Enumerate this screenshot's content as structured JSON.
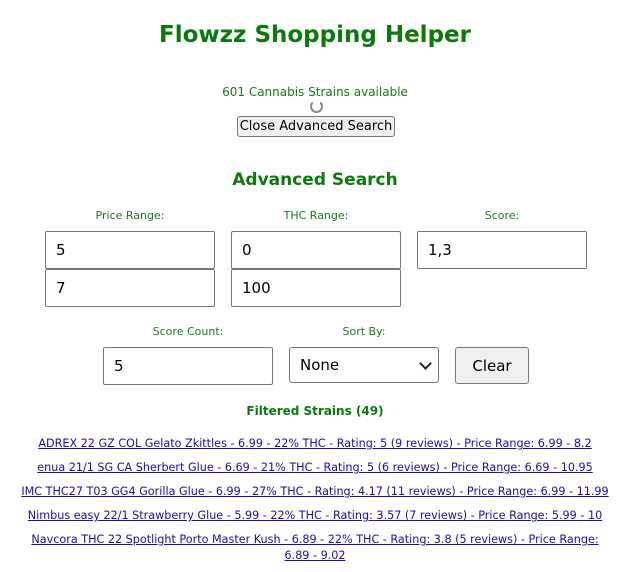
{
  "header": {
    "title": "Flowzz Shopping Helper",
    "strain_count": "601 Cannabis Strains available"
  },
  "toggle": {
    "label": "Close Advanced Search"
  },
  "advanced": {
    "title": "Advanced Search",
    "labels": {
      "price": "Price Range:",
      "thc": "THC Range:",
      "score": "Score:",
      "score_count": "Score Count:",
      "sort": "Sort By:"
    },
    "values": {
      "price_min": "5",
      "price_max": "7",
      "thc_min": "0",
      "thc_max": "100",
      "score": "1,3",
      "score_count": "5",
      "sort": "None"
    },
    "clear_label": "Clear"
  },
  "filtered": {
    "title": "Filtered Strains (49)"
  },
  "results": [
    "ADREX 22 GZ COL Gelato Zkittles - 6.99 - 22% THC - Rating: 5 (9 reviews) - Price Range: 6.99 - 8.2",
    "enua 21/1 SG CA Sherbert Glue - 6.69 - 21% THC - Rating: 5 (6 reviews) - Price Range: 6.69 - 10.95",
    "IMC THC27 T03 GG4 Gorilla Glue - 6.99 - 27% THC - Rating: 4.17 (11 reviews) - Price Range: 6.99 - 11.99",
    "Nimbus easy 22/1 Strawberry Glue - 5.99 - 22% THC - Rating: 3.57 (7 reviews) - Price Range: 5.99 - 10",
    "Navcora THC 22 Spotlight Porto Master Kush - 6.89 - 22% THC - Rating: 3.8 (5 reviews) - Price Range: 6.89 - 9.02"
  ]
}
